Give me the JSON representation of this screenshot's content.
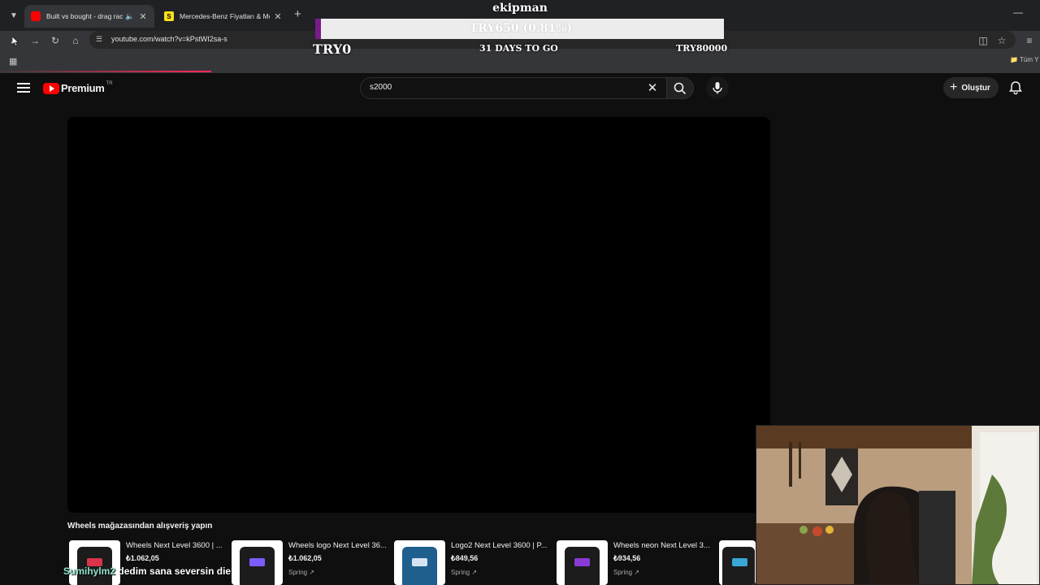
{
  "browser": {
    "tabs": [
      {
        "title": "Built vs bought - drag racin",
        "active": true,
        "favicon": "youtube-icon",
        "audio": "speaker-icon"
      },
      {
        "title": "Mercedes-Benz Fiyatları & Mo",
        "active": false,
        "favicon": "S",
        "audio": ""
      }
    ],
    "new_tab_label": "+",
    "url": "youtube.com/watch?v=kPstWI2sa-s",
    "all_bookmarks_label": "Tüm Y"
  },
  "overlay": {
    "streamer_name": "ekipman",
    "goal_text": "TRY650 (0.81%)",
    "goal_progress": 0.0081,
    "goal_start": "TRY0",
    "goal_days": "31 DAYS TO GO",
    "goal_target": "TRY80000"
  },
  "youtube": {
    "brand": "Premium",
    "region": "TR",
    "search_value": "s2000",
    "create_label": "Oluştur"
  },
  "shelf": {
    "title": "Wheels mağazasından alışveriş yapın",
    "items": [
      {
        "title": "Wheels Next Level 3600 | ...",
        "price": "₺1.062,05",
        "seller": "",
        "shirt_color": "#1c1c1c",
        "print_color": "#d9344a"
      },
      {
        "title": "Wheels logo Next Level 36...",
        "price": "₺1.062,05",
        "seller": "Spring",
        "shirt_color": "#1c1c1c",
        "print_color": "#7d5cff"
      },
      {
        "title": "Logo2 Next Level 3600 | P...",
        "price": "₺849,56",
        "seller": "Spring",
        "shirt_color": "#1e5f8e",
        "print_color": "#d6e4f2"
      },
      {
        "title": "Wheels neon Next Level 3...",
        "price": "₺934,56",
        "seller": "Spring",
        "shirt_color": "#1c1c1c",
        "print_color": "#8a3bd6"
      }
    ]
  },
  "chat": {
    "user": "Sumihylm2",
    "message": "dedim sana seversin die"
  },
  "colors": {
    "youtube_red": "#ff0000",
    "goal_fill": "#7a1a8a",
    "chat_user": "#8fe3d0"
  }
}
